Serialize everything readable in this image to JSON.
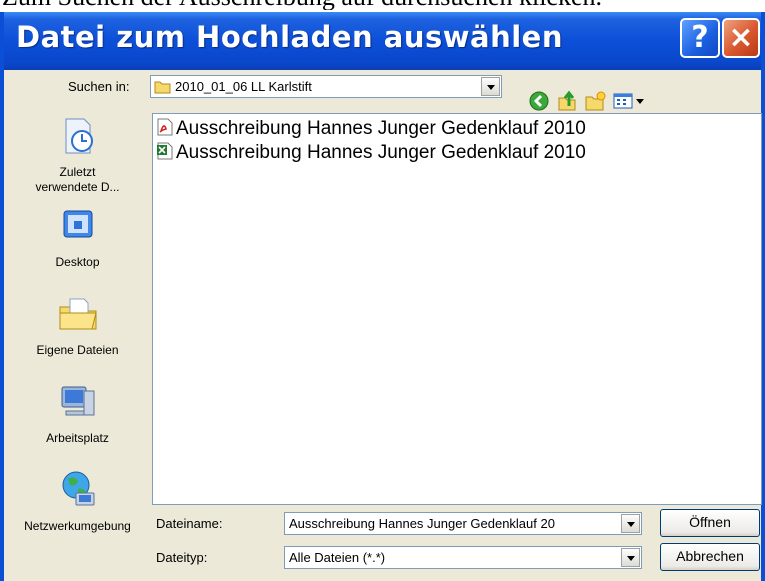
{
  "caption": "Zum Suchen der Ausschreibung auf durchsuchen klicken.",
  "window": {
    "title": "Datei zum Hochladen auswählen",
    "help_icon": "?",
    "close_icon": "×"
  },
  "toolbar": {
    "look_in_label": "Suchen in:",
    "look_in_value": "2010_01_06 LL Karlstift",
    "icons": [
      "back-icon",
      "up-folder-icon",
      "new-folder-icon",
      "view-menu-icon"
    ]
  },
  "places": [
    {
      "label": "Zuletzt verwendete D...",
      "icon": "recent-documents-icon"
    },
    {
      "label": "Desktop",
      "icon": "desktop-icon"
    },
    {
      "label": "Eigene Dateien",
      "icon": "my-documents-icon"
    },
    {
      "label": "Arbeitsplatz",
      "icon": "my-computer-icon"
    },
    {
      "label": "Netzwerkumgebung",
      "icon": "network-places-icon"
    }
  ],
  "files": [
    {
      "name": "Ausschreibung Hannes Junger Gedenklauf 2010",
      "icon": "pdf-file-icon"
    },
    {
      "name": "Ausschreibung Hannes Junger Gedenklauf 2010",
      "icon": "excel-file-icon"
    }
  ],
  "filename": {
    "label": "Dateiname:",
    "value": "Ausschreibung Hannes Junger Gedenklauf 20"
  },
  "filetype": {
    "label": "Dateityp:",
    "value": "Alle Dateien (*.*)"
  },
  "buttons": {
    "open": "Öffnen",
    "cancel": "Abbrechen"
  }
}
